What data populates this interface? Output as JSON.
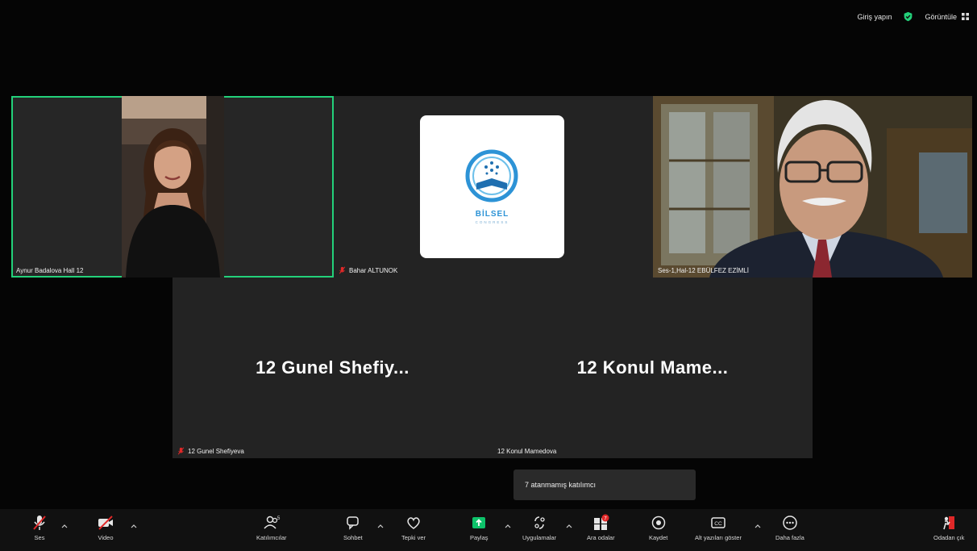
{
  "topbar": {
    "signin_label": "Giriş yapın",
    "view_label": "Görüntüle",
    "shield_color": "#23d17a"
  },
  "tiles": [
    {
      "name": "Aynur Badalova Hall 12",
      "muted": false,
      "active": true
    },
    {
      "name": "Bahar ALTUNOK",
      "muted": true,
      "active": false,
      "logo_text": "BİLSEL",
      "logo_sub": "CONGRESS"
    },
    {
      "name": "Ses-1,Hal-12 EBÜLFEZ EZİMLİ",
      "muted": false,
      "active": false
    },
    {
      "name": "12 Gunel Shefiyeva",
      "big_name": "12 Gunel Shefiy...",
      "muted": true
    },
    {
      "name": "12 Konul Mamedova",
      "big_name": "12 Konul Mame...",
      "muted": false
    }
  ],
  "toast": "7 atanmamış katılımcı",
  "toolbar": {
    "audio": "Ses",
    "video": "Video",
    "participants": "Katılımcılar",
    "participants_count": "5",
    "chat": "Sohbet",
    "reactions": "Tepki ver",
    "share": "Paylaş",
    "apps": "Uygulamalar",
    "breakout": "Ara odalar",
    "breakout_badge": "7",
    "record": "Kaydet",
    "captions": "Alt yazıları göster",
    "more": "Daha fazla",
    "leave": "Odadan çık"
  },
  "colors": {
    "accent_green": "#23d17a",
    "alert_red": "#e02828",
    "share_green": "#0dc26a"
  }
}
